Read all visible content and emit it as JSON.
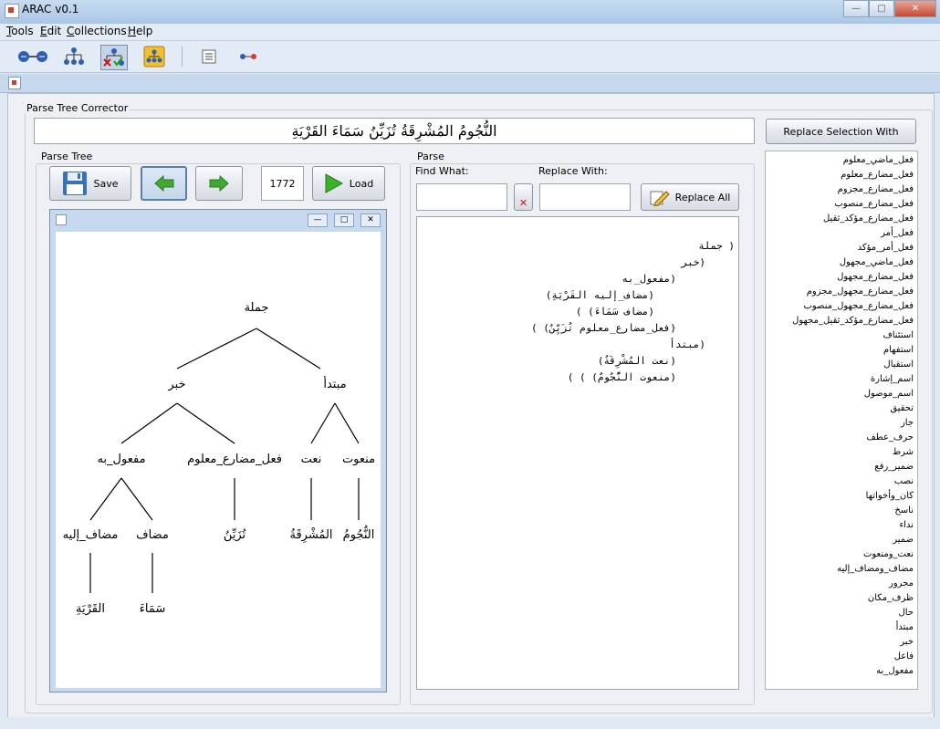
{
  "window": {
    "title": "ARAC v0.1"
  },
  "menu": [
    {
      "label": "Tools",
      "underline": "T",
      "rest": "ools"
    },
    {
      "label": "Edit",
      "underline": "E",
      "rest": "dit"
    },
    {
      "label": "Collections",
      "underline": "C",
      "rest": "ollections"
    },
    {
      "label": "Help",
      "underline": "H",
      "rest": "elp"
    }
  ],
  "toolbar": [
    {
      "icon": "nodes-icon"
    },
    {
      "icon": "tree-icon"
    },
    {
      "icon": "tree-correct-icon",
      "active": true
    },
    {
      "icon": "collection-tree-icon"
    },
    {
      "icon": "list-icon"
    },
    {
      "icon": "link-icon"
    }
  ],
  "panel": {
    "title": "Parse Tree Corrector",
    "sentence": "النُّجُومُ المُشْرِقَةُ تُزَيِّنُ سَمَاءَ القَرْيَةِ",
    "replace_selection_label": "Replace Selection With"
  },
  "tree_panel": {
    "title": "Parse Tree",
    "save_label": "Save",
    "sentence_number": "1772",
    "load_label": "Load"
  },
  "parse_panel": {
    "title": "Parse",
    "find_label": "Find What:",
    "find_value": "",
    "replace_label": "Replace With:",
    "replace_value": "",
    "replace_all_label": "Replace All",
    "lines": [
      "( جملة",
      "(خبر",
      "(مفعول_به",
      "(مضاف_إليه القَرْيَةِ)",
      "(مضاف سَمَاءَ) )",
      "(فعل_مضارع_معلوم تُزَيِّنُ) )",
      "(مبتدأ",
      "(نعت المُشْرِقَةُ)",
      "(منعوت النُّجُومُ) ) )"
    ]
  },
  "tree_nodes": {
    "root": "جملة",
    "khabar": "خبر",
    "mubtada": "مبتدأ",
    "mafool": "مفعول_به",
    "fel": "فعل_مضارع_معلوم",
    "naat": "نعت",
    "manoot": "منعوت",
    "mudafilayh": "مضاف_إليه",
    "mudaf": "مضاف",
    "w_tuzayyin": "تُزَيِّنُ",
    "w_mushriqa": "المُشْرِقَةُ",
    "w_nujum": "النُّجُومُ",
    "w_qarya": "القَرْيَةِ",
    "w_samaa": "سَمَاءَ"
  },
  "tags": [
    "فعل_ماضي_معلوم",
    "فعل_مضارع_معلوم",
    "فعل_مضارع_مجزوم",
    "فعل_مضارع_منصوب",
    "فعل_مضارع_مؤكد_ثقيل",
    "فعل_أمر",
    "فعل_أمر_مؤكد",
    "فعل_ماضي_مجهول",
    "فعل_مضارع_مجهول",
    "فعل_مضارع_مجهول_مجزوم",
    "فعل_مضارع_مجهول_منصوب",
    "فعل_مضارع_مؤكد_ثقيل_مجهول",
    "استئناف",
    "استفهام",
    "استقبال",
    "اسم_إشارة",
    "اسم_موصول",
    "تحقيق",
    "جار",
    "حرف_عطف",
    "شرط",
    "ضمير_رفع",
    "نصب",
    "كان_وأخواتها",
    "ناسخ",
    "نداء",
    "ضمير",
    "نعت_ومنعوت",
    "مضاف_ومضاف_إليه",
    "مجرور",
    "ظرف_مكان",
    "حال",
    "مبتدأ",
    "خبر",
    "فاعل",
    "مفعول_به"
  ]
}
